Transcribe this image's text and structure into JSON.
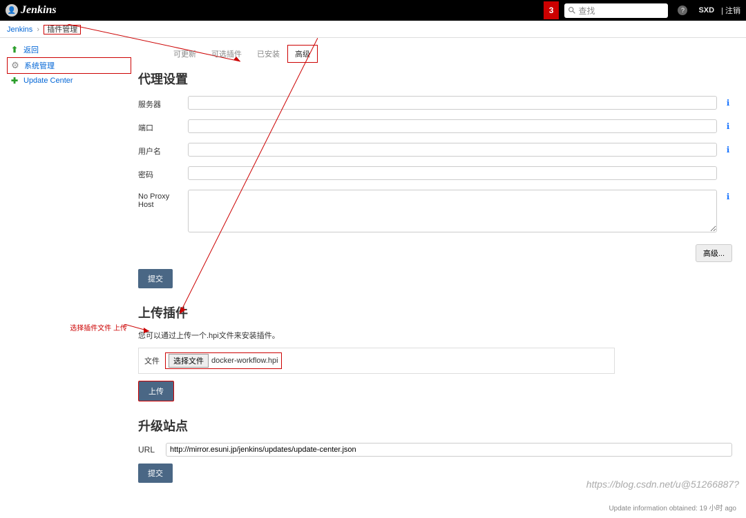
{
  "header": {
    "product": "Jenkins",
    "notif_count": "3",
    "search_placeholder": "查找",
    "username": "SXD",
    "logout": "| 注销"
  },
  "breadcrumbs": {
    "items": [
      "Jenkins",
      "插件管理"
    ]
  },
  "sidebar": {
    "back": "返回",
    "manage": "系统管理",
    "update_center": "Update Center"
  },
  "annotation": {
    "select_upload": "选择插件文件 上传"
  },
  "tabs": {
    "items": [
      {
        "label": "可更新",
        "active": false
      },
      {
        "label": "可选插件",
        "active": false
      },
      {
        "label": "已安装",
        "active": false
      },
      {
        "label": "高级",
        "active": true
      }
    ]
  },
  "proxy": {
    "heading": "代理设置",
    "server_label": "服务器",
    "port_label": "端口",
    "user_label": "用户名",
    "password_label": "密码",
    "noproxy_label": "No Proxy Host",
    "advanced_btn": "高级...",
    "submit_btn": "提交"
  },
  "upload": {
    "heading": "上传插件",
    "hint": "您可以通过上传一个.hpi文件来安装插件。",
    "file_label": "文件",
    "choose_btn": "选择文件",
    "chosen_file": "docker-workflow.hpi",
    "upload_btn": "上传"
  },
  "site": {
    "heading": "升级站点",
    "url_label": "URL",
    "url_value": "http://mirror.esuni.jp/jenkins/updates/update-center.json",
    "submit_btn": "提交"
  },
  "footer": {
    "update_info": "Update information obtained: 19 小时 ago"
  },
  "watermark": "https://blog.csdn.net/u@51266887?"
}
